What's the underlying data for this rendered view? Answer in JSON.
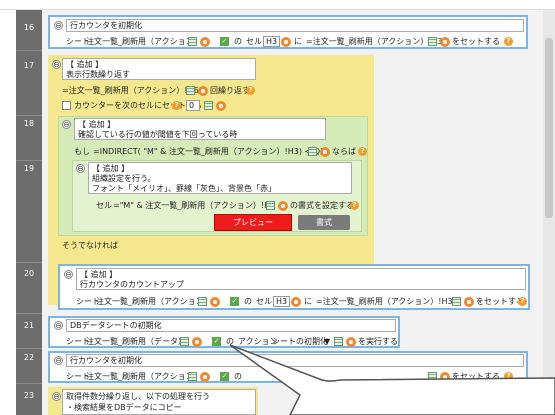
{
  "header": {
    "label": ""
  },
  "line_numbers": [
    "16",
    "17",
    "18",
    "19",
    "20",
    "21",
    "22",
    "23"
  ],
  "common": {
    "sheet": "シート",
    "no": "の",
    "cell": "セル",
    "ni": "に",
    "set_suffix": "をセットする",
    "collapse_symbol": "⊖",
    "help_symbol": "?",
    "check_symbol": "✓"
  },
  "blk16": {
    "title": "行カウンタを初期化",
    "sheet_name": "注文一覧_刷新用（アクション）",
    "cell": "H3",
    "formula": "=注文一覧_刷新用（アクション）!B3"
  },
  "blk17": {
    "tag": "【 追加 】",
    "title": "表示行数繰り返す",
    "formula": "=注文一覧_刷新用（アクション）!D6",
    "repeat_label": "回繰り返す",
    "counter_label": "カウンターを次のセルにセットする",
    "counter_value": "0"
  },
  "blk18": {
    "tag": "【 追加 】",
    "title": "確認している行の値が閾値を下回っている時",
    "if_label": "もし",
    "condition": "=INDIRECT( \"M\" & 注文一覧_刷新用（アクション）!H3) < Q1",
    "then_label": "ならば"
  },
  "blk19": {
    "tag": "【 追加 】",
    "line1": "組織設定を行う。",
    "line2": "フォント「メイリオ」、罫線「灰色」、背景色「赤」",
    "cell_formula": "=\"M\" & 注文一覧_刷新用（アクション）!H3",
    "style_label": "の書式を設定する",
    "preview_label": "プレビュー",
    "style_button": "書式",
    "else_label": "そうでなければ"
  },
  "blk20": {
    "tag": "【 追加 】",
    "title": "行カウンタのカウントアップ",
    "sheet_name": "注文一覧_刷新用（アクション）",
    "cell": "H3",
    "formula": "=注文一覧_刷新用（アクション）!H3 + 1"
  },
  "blk21": {
    "title": "DBデータシートの初期化",
    "sheet_name": "注文一覧_刷新用（データ）",
    "action_label": "アクション",
    "action_value": "シートの初期化",
    "run_label": "を実行する"
  },
  "blk22": {
    "title": "行カウンタを初期化",
    "sheet_name": "注文一覧_刷新用（アクション）"
  },
  "blk23": {
    "line1": "取得件数分繰り返し、以下の処理を行う",
    "line2": "・検索結果をDBデータにコピー"
  },
  "colors": {
    "blue_border": "#7eb5de",
    "yellow": "#f6e88e",
    "green": "#d5ecb8",
    "gutter": "#6d6d6d",
    "preview_red": "#ee1c1c"
  }
}
